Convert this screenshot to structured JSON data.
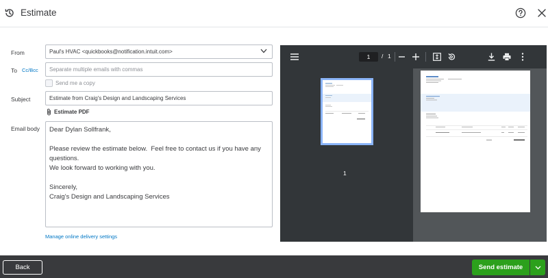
{
  "header": {
    "title": "Estimate",
    "icons": [
      "history-icon",
      "help-icon",
      "close-icon"
    ]
  },
  "form": {
    "from_label": "From",
    "from_value": "Paul's HVAC <quickbooks@notification.intuit.com>",
    "to_label": "To",
    "cc_bcc_label": "Cc/Bcc",
    "to_placeholder": "Separate multiple emails with commas",
    "send_me_copy_label": "Send me a copy",
    "send_me_copy_checked": false,
    "subject_label": "Subject",
    "subject_value": "Estimate from Craig's Design and Landscaping Services",
    "attachment_label": "Estimate PDF",
    "email_body_label": "Email body",
    "email_body": "Dear Dylan Sollfrank,\n\nPlease review the estimate below.  Feel free to contact us if you have any questions.\nWe look forward to working with you.\n\nSincerely,\nCraig's Design and Landscaping Services",
    "manage_link": "Manage online delivery settings"
  },
  "pdf_viewer": {
    "current_page": "1",
    "page_separator": "/",
    "total_pages": "1",
    "thumbnail_label": "1"
  },
  "footer": {
    "back_label": "Back",
    "send_label": "Send estimate"
  },
  "colors": {
    "accent_green": "#2ca01c",
    "link_blue": "#0077c5",
    "footer_bg": "#393a3d",
    "viewer_bg": "#525659",
    "viewer_toolbar": "#323639"
  }
}
